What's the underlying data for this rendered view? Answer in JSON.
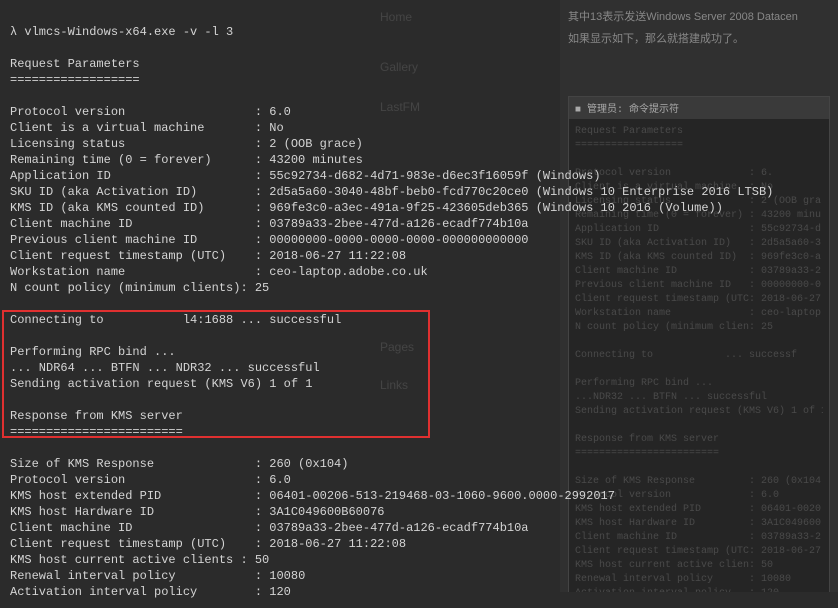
{
  "cmd": {
    "prompt_char": "λ",
    "command": "vlmcs-Windows-x64.exe -v -l 3"
  },
  "headers": {
    "req_params": "Request Parameters",
    "underline1": "==================",
    "connecting_prefix": "Connecting to ",
    "connecting_mid": "          ",
    "connecting_suffix": "l4:1688 ... successful",
    "rpc_bind": "Performing RPC bind ...",
    "ndr_line": "... NDR64 ... BTFN ... NDR32 ... successful",
    "send_act": "Sending activation request (KMS V6) 1 of 1",
    "response_hdr": "Response from KMS server",
    "underline2": "========================"
  },
  "request": [
    {
      "label": "Protocol version",
      "value": "6.0"
    },
    {
      "label": "Client is a virtual machine",
      "value": "No"
    },
    {
      "label": "Licensing status",
      "value": "2 (OOB grace)"
    },
    {
      "label": "Remaining time (0 = forever)",
      "value": "43200 minutes"
    },
    {
      "label": "Application ID",
      "value": "55c92734-d682-4d71-983e-d6ec3f16059f",
      "note": "(Windows)"
    },
    {
      "label": "SKU ID (aka Activation ID)",
      "value": "2d5a5a60-3040-48bf-beb0-fcd770c20ce0",
      "note": "(Windows 10 Enterprise 2016 LTSB)"
    },
    {
      "label": "KMS ID (aka KMS counted ID)",
      "value": "969fe3c0-a3ec-491a-9f25-423605deb365",
      "note": "(Windows 10 2016 (Volume))"
    },
    {
      "label": "Client machine ID",
      "value": "03789a33-2bee-477d-a126-ecadf774b10a"
    },
    {
      "label": "Previous client machine ID",
      "value": "00000000-0000-0000-0000-000000000000"
    },
    {
      "label": "Client request timestamp (UTC)",
      "value": "2018-06-27 11:22:08"
    },
    {
      "label": "Workstation name",
      "value": "ceo-laptop.adobe.co.uk"
    },
    {
      "label": "N count policy (minimum clients)",
      "value": "25"
    }
  ],
  "response": [
    {
      "label": "Size of KMS Response",
      "value": "260 (0x104)"
    },
    {
      "label": "Protocol version",
      "value": "6.0"
    },
    {
      "label": "KMS host extended PID",
      "value": "06401-00206-513-219468-03-1060-9600.0000-2992017"
    },
    {
      "label": "KMS host Hardware ID",
      "value": "3A1C049600B60076"
    },
    {
      "label": "Client machine ID",
      "value": "03789a33-2bee-477d-a126-ecadf774b10a"
    },
    {
      "label": "Client request timestamp (UTC)",
      "value": "2018-06-27 11:22:08"
    },
    {
      "label": "KMS host current active clients",
      "value": "50"
    },
    {
      "label": "Renewal interval policy",
      "value": "10080"
    },
    {
      "label": "Activation interval policy",
      "value": "120"
    }
  ],
  "bg_nav": {
    "home": "Home",
    "gallery": "Gallery",
    "lastfm": "LastFM",
    "pages": "Pages",
    "links": "Links"
  },
  "right": {
    "line1": "其中13表示发送Windows Server 2008 Datacen",
    "line2": "如果显示如下，那么就搭建成功了。",
    "panel_title": "■ 管理员: 命令提示符"
  }
}
